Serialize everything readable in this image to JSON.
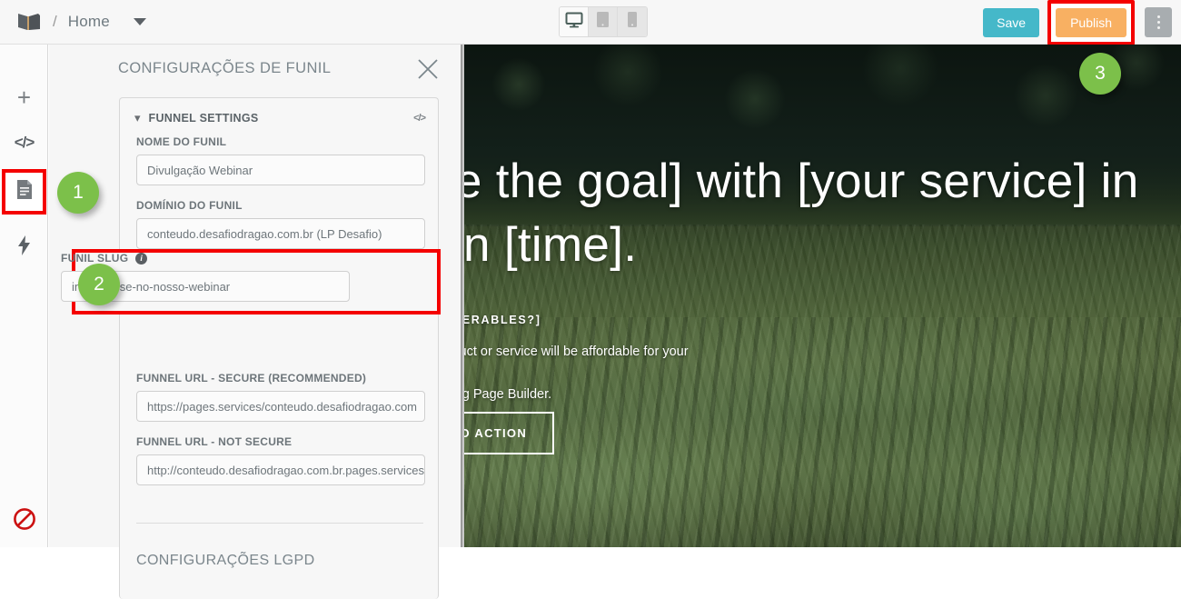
{
  "topbar": {
    "logo_icon": "book-logo-icon",
    "breadcrumb_separator": "/",
    "breadcrumb_home": "Home",
    "dropdown_icon": "chevron-down-icon",
    "device_buttons": [
      {
        "name": "desktop",
        "icon": "desktop-icon",
        "active": true
      },
      {
        "name": "tablet",
        "icon": "tablet-icon",
        "active": false
      },
      {
        "name": "mobile",
        "icon": "mobile-icon",
        "active": false
      }
    ],
    "save_label": "Save",
    "publish_label": "Publish",
    "kebab_icon": "more-vertical-icon",
    "save_color": "#45b8c9",
    "publish_color": "#f8b062",
    "highlight_color": "#f40000"
  },
  "rail": {
    "items": [
      {
        "icon": "plus-icon",
        "label": ""
      },
      {
        "icon": "code-icon",
        "label": ""
      },
      {
        "icon": "document-icon",
        "label": "",
        "highlighted": true
      },
      {
        "icon": "lightning-bolt-icon",
        "label": ""
      }
    ],
    "bottom_icon": "prohibited-icon"
  },
  "panel": {
    "title": "CONFIGURAÇÕES DE FUNIL",
    "close_icon": "close-icon",
    "card": {
      "chevron_icon": "chevron-down-icon",
      "section_title": "FUNNEL SETTINGS",
      "code_icon": "code-icon",
      "fields": [
        {
          "label": "NOME DO FUNIL",
          "value": "Divulgação Webinar",
          "info": false
        },
        {
          "label": "DOMÍNIO DO FUNIL",
          "value": "conteudo.desafiodragao.com.br (LP Desafio)",
          "info": false
        },
        {
          "label": "FUNIL SLUG",
          "value": "inscreva-se-no-nosso-webinar",
          "info": true,
          "info_icon": "info-icon",
          "highlighted": true
        },
        {
          "label": "FUNNEL URL - SECURE (RECOMMENDED)",
          "value": "https://pages.services/conteudo.desafiodragao.com",
          "info": false
        },
        {
          "label": "FUNNEL URL - NOT SECURE",
          "value": "http://conteudo.desafiodragao.com.br.pages.services/i",
          "info": false
        }
      ],
      "lgpd_title": "CONFIGURAÇÕES LGPD"
    }
  },
  "badges": [
    {
      "number": "1",
      "color": "#7cc04a"
    },
    {
      "number": "2",
      "color": "#7cc04a"
    },
    {
      "number": "3",
      "color": "#7cc04a"
    }
  ],
  "preview": {
    "heading": "[Achieve the goal] with [your service] in\nless than [time].",
    "kicker": "[WHAT ARE YOUR DELIVERABLES?]",
    "body": "[Explain here how your product or service will be affordable for your\ncustomers]\nBuilt with LeadSpring Landing Page Builder.",
    "cta_label": "CALL TO ACTION"
  }
}
